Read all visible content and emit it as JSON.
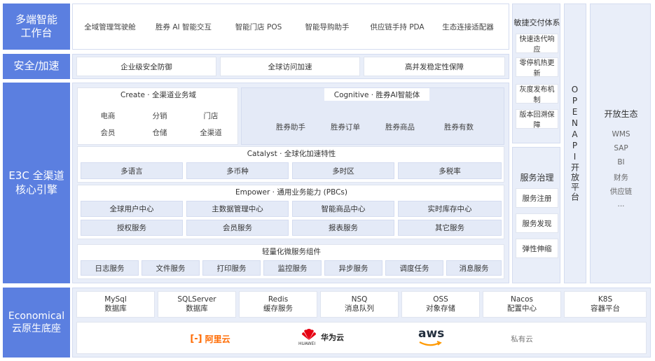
{
  "rows": {
    "multi": {
      "label": "多端智能\n工作台",
      "items": [
        "全域管理驾驶舱",
        "胜券 AI 智能交互",
        "智能门店 POS",
        "智能导购助手",
        "供应链手持 PDA",
        "生态连接适配器"
      ]
    },
    "security": {
      "label": "安全/加速",
      "items": [
        "企业级安全防御",
        "全球访问加速",
        "高并发稳定性保障"
      ]
    },
    "core": {
      "label": "E3C 全渠道\n核心引擎",
      "create": {
        "title": "Create · 全渠道业务域",
        "items": [
          "电商",
          "分销",
          "门店",
          "会员",
          "仓储",
          "全渠道"
        ]
      },
      "cognitive": {
        "title": "Cognitive · 胜券AI智能体",
        "items": [
          "胜券助手",
          "胜券订单",
          "胜券商品",
          "胜券有数"
        ]
      },
      "catalyst": {
        "title": "Catalyst · 全球化加速特性",
        "items": [
          "多语言",
          "多币种",
          "多时区",
          "多税率"
        ]
      },
      "empower": {
        "title": "Empower · 通用业务能力 (PBCs)",
        "items": [
          "全球用户中心",
          "主数据管理中心",
          "智能商品中心",
          "实时库存中心",
          "授权服务",
          "会员服务",
          "报表服务",
          "其它服务"
        ]
      },
      "micro": {
        "title": "轻量化微服务组件",
        "items": [
          "日志服务",
          "文件服务",
          "打印服务",
          "监控服务",
          "异步服务",
          "调度任务",
          "消息服务"
        ]
      }
    },
    "economical": {
      "label": "Economical\n云原生底座",
      "items": [
        {
          "name": "MySql",
          "desc": "数据库"
        },
        {
          "name": "SQLServer",
          "desc": "数据库"
        },
        {
          "name": "Redis",
          "desc": "缓存服务"
        },
        {
          "name": "NSQ",
          "desc": "消息队列"
        },
        {
          "name": "OSS",
          "desc": "对象存储"
        },
        {
          "name": "Nacos",
          "desc": "配置中心"
        },
        {
          "name": "K8S",
          "desc": "容器平台"
        }
      ],
      "clouds": {
        "aliyun": "阿里云",
        "huawei": "华为云",
        "huawei_sub": "HUAWEI",
        "aws": "aws",
        "private": "私有云"
      }
    }
  },
  "agile": {
    "title": "敏捷交付体系",
    "items": [
      "快速迭代响应",
      "零停机热更新",
      "灰度发布机制",
      "版本回溯保障"
    ]
  },
  "governance": {
    "title": "服务治理",
    "items": [
      "服务注册",
      "服务发现",
      "弹性伸缩"
    ]
  },
  "openapi": {
    "text": "OPENAPI开放平台"
  },
  "ecosystem": {
    "title": "开放生态",
    "items": [
      "WMS",
      "SAP",
      "BI",
      "财务",
      "供应链",
      "..."
    ]
  },
  "colors": {
    "accent": "#5b7fe0",
    "aliyun": "#ff6a00",
    "huawei": "#e60012",
    "aws_smile": "#ff9900"
  }
}
